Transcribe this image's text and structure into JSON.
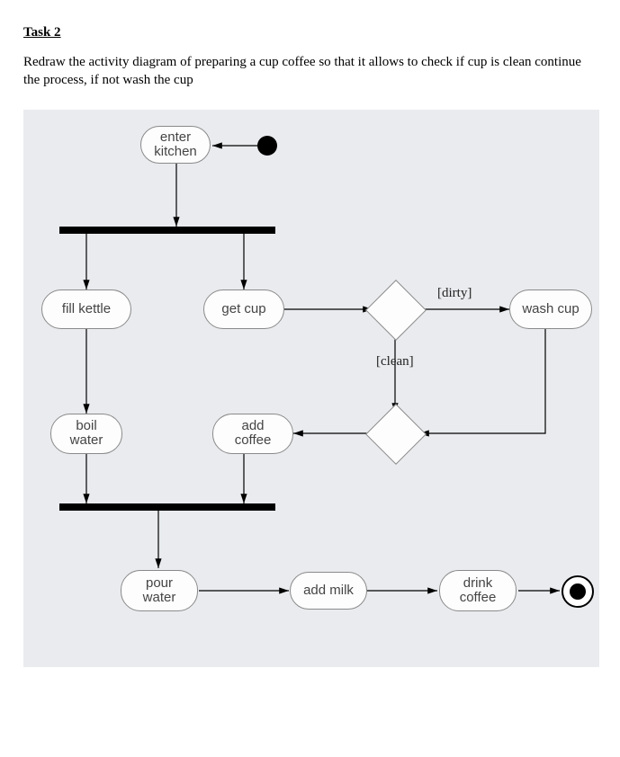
{
  "task": {
    "title": "Task 2",
    "description": "Redraw the activity diagram of preparing a cup coffee so that it allows to check if cup is clean continue the process, if not wash the cup"
  },
  "diagram": {
    "activities": {
      "enter_kitchen": "enter\nkitchen",
      "fill_kettle": "fill kettle",
      "get_cup": "get cup",
      "wash_cup": "wash cup",
      "boil_water": "boil\nwater",
      "add_coffee": "add\ncoffee",
      "pour_water": "pour\nwater",
      "add_milk": "add milk",
      "drink_coffee": "drink\ncoffee"
    },
    "guards": {
      "dirty": "[dirty]",
      "clean": "[clean]"
    }
  }
}
